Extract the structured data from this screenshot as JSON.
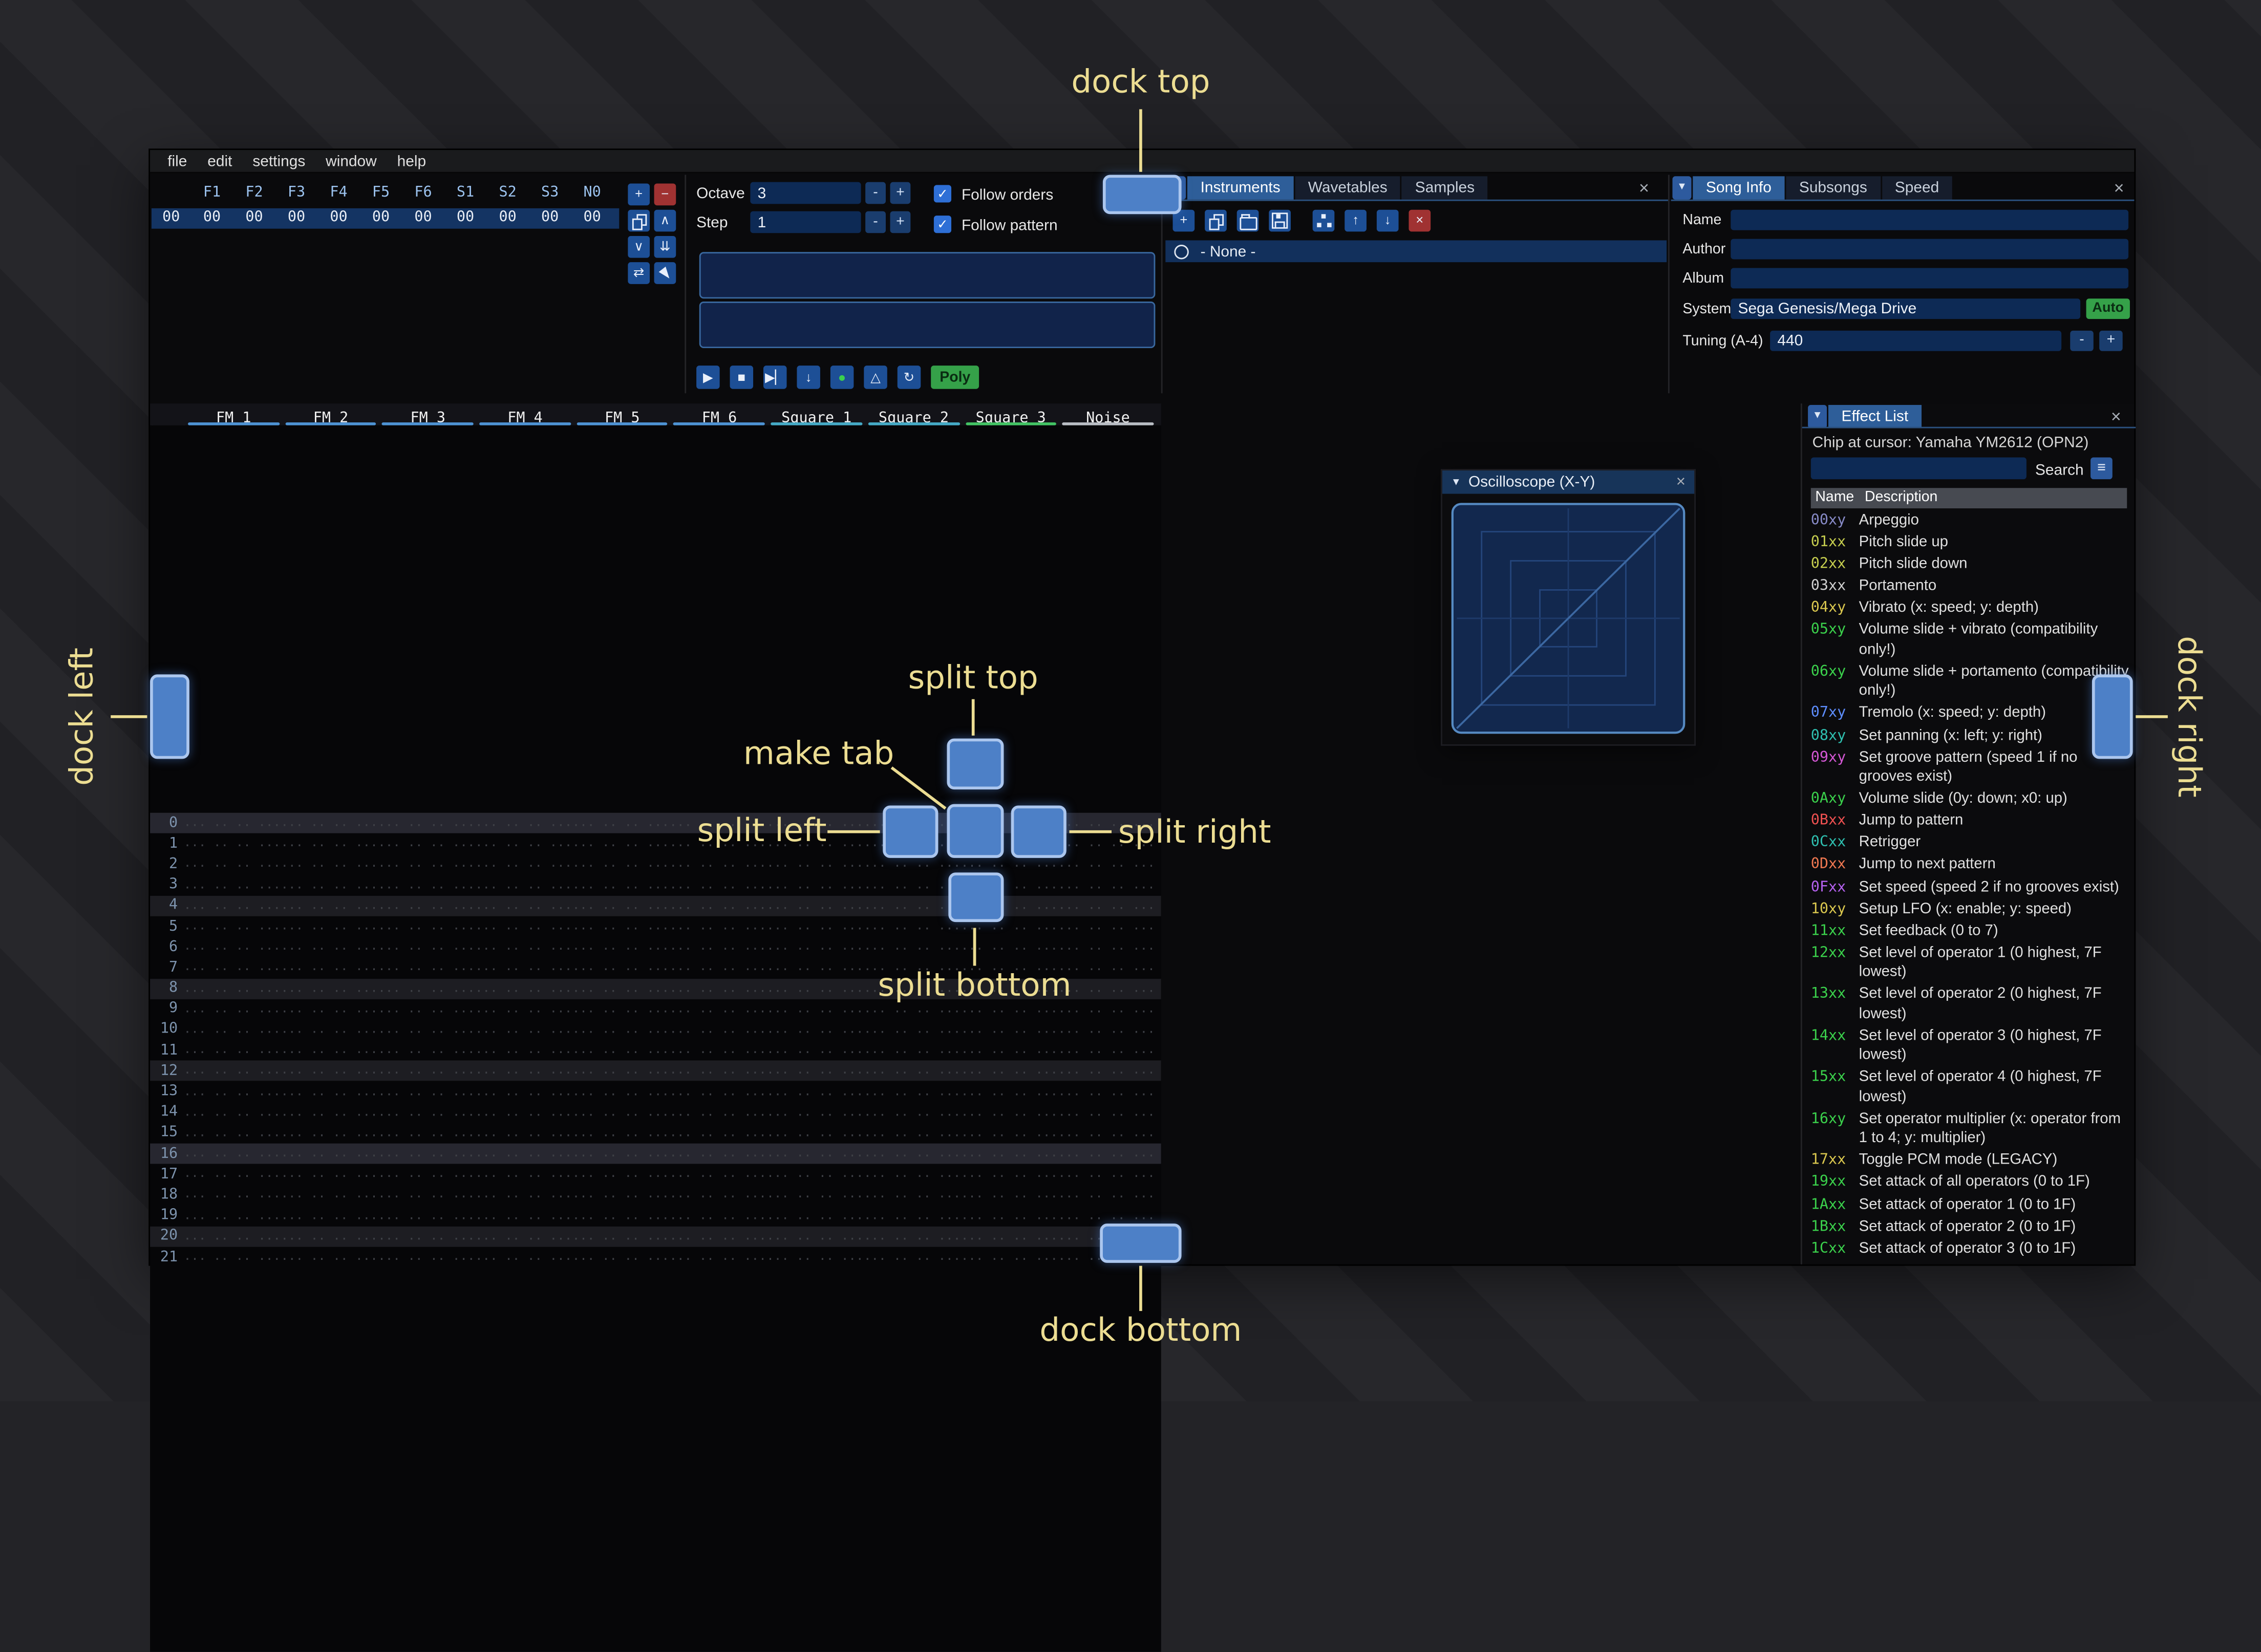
{
  "annotations": {
    "dock_top": "dock top",
    "dock_bottom": "dock bottom",
    "dock_left": "dock left",
    "dock_right": "dock right",
    "split_top": "split top",
    "split_bottom": "split bottom",
    "split_left": "split left",
    "split_right": "split right",
    "make_tab": "make tab"
  },
  "colors": {
    "annotation_yellow": "#ecdd92",
    "dock_button_blue": "#4d80c7",
    "active_tab_blue": "#2e5e99",
    "selection_blue": "#143463",
    "auto_button_green": "#35a149",
    "record_green": "#3ad14e"
  },
  "menu": {
    "items": [
      "file",
      "edit",
      "settings",
      "window",
      "help"
    ]
  },
  "orders": {
    "channel_headers": [
      "F1",
      "F2",
      "F3",
      "F4",
      "F5",
      "F6",
      "S1",
      "S2",
      "S3",
      "N0"
    ],
    "row_index": "00",
    "row_values": [
      "00",
      "00",
      "00",
      "00",
      "00",
      "00",
      "00",
      "00",
      "00",
      "00"
    ],
    "buttons": [
      {
        "name": "order-add-button",
        "icon": "plus-icon",
        "variant": ""
      },
      {
        "name": "order-remove-button",
        "icon": "minus-icon",
        "variant": "red"
      },
      {
        "name": "order-duplicate-button",
        "icon": "duplicate-icon",
        "variant": ""
      },
      {
        "name": "order-move-up-button",
        "icon": "chevron-up-icon",
        "variant": ""
      },
      {
        "name": "order-move-down-button",
        "icon": "chevron-down-icon",
        "variant": ""
      },
      {
        "name": "order-duplicate-end-button",
        "icon": "double-down-icon",
        "variant": ""
      },
      {
        "name": "order-change-all-button",
        "icon": "swap-icon",
        "variant": ""
      },
      {
        "name": "order-edit-mode-button",
        "icon": "pointer-icon",
        "variant": ""
      }
    ]
  },
  "controls": {
    "octave": {
      "label": "Octave",
      "value": "3",
      "minus": "-",
      "plus": "+"
    },
    "step": {
      "label": "Step",
      "value": "1",
      "minus": "-",
      "plus": "+"
    },
    "follow_orders": "Follow orders",
    "follow_pattern": "Follow pattern",
    "playback_buttons": [
      {
        "name": "play-button",
        "icon": "play-icon"
      },
      {
        "name": "stop-button",
        "icon": "stop-icon"
      },
      {
        "name": "play-from-cursor-button",
        "icon": "play-cursor-icon"
      },
      {
        "name": "step-row-button",
        "icon": "step-down-icon"
      },
      {
        "name": "record-button",
        "icon": "record-icon"
      },
      {
        "name": "metronome-button",
        "icon": "metronome-icon"
      },
      {
        "name": "repeat-pattern-button",
        "icon": "repeat-icon"
      },
      {
        "name": "poly-button",
        "label": "Poly"
      }
    ]
  },
  "instruments": {
    "tabs": [
      {
        "label": "Instruments",
        "active": true
      },
      {
        "label": "Wavetables",
        "active": false
      },
      {
        "label": "Samples",
        "active": false
      }
    ],
    "toolbar": [
      {
        "name": "instrument-add-button",
        "icon": "plus-icon",
        "variant": ""
      },
      {
        "name": "instrument-duplicate-button",
        "icon": "duplicate-icon",
        "variant": ""
      },
      {
        "name": "instrument-open-button",
        "icon": "folder-open-icon",
        "variant": ""
      },
      {
        "name": "instrument-save-button",
        "icon": "floppy-icon",
        "variant": ""
      },
      {
        "name": "instrument-folder-view-button",
        "icon": "sitemap-icon",
        "variant": ""
      },
      {
        "name": "instrument-move-up-button",
        "icon": "arrow-up-icon",
        "variant": ""
      },
      {
        "name": "instrument-move-down-button",
        "icon": "arrow-down-icon",
        "variant": ""
      },
      {
        "name": "instrument-delete-button",
        "icon": "close-icon",
        "variant": "red"
      }
    ],
    "list": [
      {
        "label": "- None -",
        "selected": true
      }
    ]
  },
  "song_info": {
    "tabs": [
      {
        "label": "Song Info",
        "active": true
      },
      {
        "label": "Subsongs",
        "active": false
      },
      {
        "label": "Speed",
        "active": false
      }
    ],
    "fields": [
      {
        "label": "Name",
        "value": ""
      },
      {
        "label": "Author",
        "value": ""
      },
      {
        "label": "Album",
        "value": ""
      }
    ],
    "system": {
      "label": "System",
      "value": "Sega Genesis/Mega Drive",
      "auto_label": "Auto"
    },
    "tuning": {
      "label": "Tuning (A-4)",
      "value": "440",
      "minus": "-",
      "plus": "+"
    }
  },
  "pattern": {
    "corner_label": "++",
    "channels": [
      {
        "name": "FM 1",
        "color": "#4e93d4"
      },
      {
        "name": "FM 2",
        "color": "#4e93d4"
      },
      {
        "name": "FM 3",
        "color": "#4e93d4"
      },
      {
        "name": "FM 4",
        "color": "#4e93d4"
      },
      {
        "name": "FM 5",
        "color": "#4e93d4"
      },
      {
        "name": "FM 6",
        "color": "#4e93d4"
      },
      {
        "name": "Square 1",
        "color": "#45aac6"
      },
      {
        "name": "Square 2",
        "color": "#45aac6"
      },
      {
        "name": "Square 3",
        "color": "#43c364"
      },
      {
        "name": "Noise",
        "color": "#b9bdc4"
      }
    ],
    "row_numbers": [
      "0",
      "1",
      "2",
      "3",
      "4",
      "5",
      "6",
      "7",
      "8",
      "9",
      "10",
      "11",
      "12",
      "13",
      "14",
      "15",
      "16",
      "17",
      "18",
      "19",
      "20",
      "21"
    ],
    "empty_cell": "... .. .. ..."
  },
  "oscilloscope": {
    "title": "Oscilloscope (X-Y)"
  },
  "effect_list": {
    "tab_label": "Effect List",
    "chip_line": "Chip at cursor: Yamaha YM2612 (OPN2)",
    "search_label": "Search",
    "columns": [
      "Name",
      "Description"
    ],
    "effects": [
      {
        "code": "00xy",
        "color": "#888bc8",
        "desc": "Arpeggio"
      },
      {
        "code": "01xx",
        "color": "#c6ce4f",
        "desc": "Pitch slide up"
      },
      {
        "code": "02xx",
        "color": "#c6ce4f",
        "desc": "Pitch slide down"
      },
      {
        "code": "03xx",
        "color": "#d0d0d0",
        "desc": "Portamento"
      },
      {
        "code": "04xy",
        "color": "#dbc84f",
        "desc": "Vibrato (x: speed; y: depth)"
      },
      {
        "code": "05xy",
        "color": "#3bd14c",
        "desc": "Volume slide + vibrato (compatibility only!)"
      },
      {
        "code": "06xy",
        "color": "#3bd14c",
        "desc": "Volume slide + portamento (compatibility only!)"
      },
      {
        "code": "07xy",
        "color": "#5e8eff",
        "desc": "Tremolo (x: speed; y: depth)"
      },
      {
        "code": "08xy",
        "color": "#2fc0b0",
        "desc": "Set panning (x: left; y: right)"
      },
      {
        "code": "09xy",
        "color": "#d457d4",
        "desc": "Set groove pattern (speed 1 if no grooves exist)"
      },
      {
        "code": "0Axy",
        "color": "#3bd14c",
        "desc": "Volume slide (0y: down; x0: up)"
      },
      {
        "code": "0Bxx",
        "color": "#f05151",
        "desc": "Jump to pattern"
      },
      {
        "code": "0Cxx",
        "color": "#2fc0b0",
        "desc": "Retrigger"
      },
      {
        "code": "0Dxx",
        "color": "#f07851",
        "desc": "Jump to next pattern"
      },
      {
        "code": "0Fxx",
        "color": "#b561ef",
        "desc": "Set speed (speed 2 if no grooves exist)"
      },
      {
        "code": "10xy",
        "color": "#dbc84f",
        "desc": "Setup LFO (x: enable; y: speed)"
      },
      {
        "code": "11xx",
        "color": "#3bd14c",
        "desc": "Set feedback (0 to 7)"
      },
      {
        "code": "12xx",
        "color": "#3bd14c",
        "desc": "Set level of operator 1 (0 highest, 7F lowest)"
      },
      {
        "code": "13xx",
        "color": "#3bd14c",
        "desc": "Set level of operator 2 (0 highest, 7F lowest)"
      },
      {
        "code": "14xx",
        "color": "#3bd14c",
        "desc": "Set level of operator 3 (0 highest, 7F lowest)"
      },
      {
        "code": "15xx",
        "color": "#3bd14c",
        "desc": "Set level of operator 4 (0 highest, 7F lowest)"
      },
      {
        "code": "16xy",
        "color": "#3bd14c",
        "desc": "Set operator multiplier (x: operator from 1 to 4; y: multiplier)"
      },
      {
        "code": "17xx",
        "color": "#dbc84f",
        "desc": "Toggle PCM mode (LEGACY)"
      },
      {
        "code": "19xx",
        "color": "#3bd14c",
        "desc": "Set attack of all operators (0 to 1F)"
      },
      {
        "code": "1Axx",
        "color": "#3bd14c",
        "desc": "Set attack of operator 1 (0 to 1F)"
      },
      {
        "code": "1Bxx",
        "color": "#3bd14c",
        "desc": "Set attack of operator 2 (0 to 1F)"
      },
      {
        "code": "1Cxx",
        "color": "#3bd14c",
        "desc": "Set attack of operator 3 (0 to 1F)"
      }
    ]
  }
}
